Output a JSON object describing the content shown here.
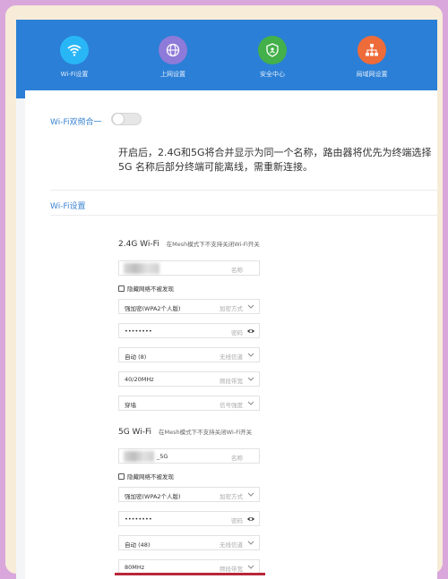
{
  "nav": {
    "items": [
      {
        "label": "Wi-Fi设置",
        "icon": "wifi-icon",
        "color": "#29b6f6"
      },
      {
        "label": "上网设置",
        "icon": "globe-icon",
        "color": "#8e7ad8"
      },
      {
        "label": "安全中心",
        "icon": "shield-icon",
        "color": "#43b04a"
      },
      {
        "label": "局域网设置",
        "icon": "network-icon",
        "color": "#ee6b3a"
      }
    ]
  },
  "dual_band": {
    "label": "Wi-Fi双频合一",
    "enabled": false,
    "description": "开启后，2.4G和5G将合并显示为同一个名称，路由器将优先为终端选择5G 名称后部分终端可能离线，需重新连接。"
  },
  "section_title": "Wi-Fi设置",
  "band_24": {
    "title": "2.4G Wi-Fi",
    "note": "在Mesh模式下不支持关闭Wi-Fi开关",
    "name_hint": "名称",
    "hide_label": "隐藏网络不被发现",
    "encryption_value": "强加密(WPA2个人版)",
    "encryption_hint": "加密方式",
    "password_value": "••••••••",
    "password_hint": "密码",
    "channel_value": "自动 (8)",
    "channel_hint": "无线信道",
    "bandwidth_value": "40/20MHz",
    "bandwidth_hint": "频段带宽",
    "signal_value": "穿墙",
    "signal_hint": "信号强度"
  },
  "band_5": {
    "title": "5G Wi-Fi",
    "note": "在Mesh模式下不支持关闭Wi-Fi开关",
    "name_suffix": "_5G",
    "name_hint": "名称",
    "hide_label": "隐藏网络不被发现",
    "encryption_value": "强加密(WPA2个人版)",
    "encryption_hint": "加密方式",
    "password_value": "••••••••",
    "password_hint": "密码",
    "channel_value": "自动 (48)",
    "channel_hint": "无线信道",
    "bandwidth_value": "80MHz",
    "bandwidth_hint": "频段带宽"
  },
  "colors": {
    "topbar": "#2b7fd6",
    "accent": "#3a83d1",
    "highlight_line": "#b8273a"
  }
}
